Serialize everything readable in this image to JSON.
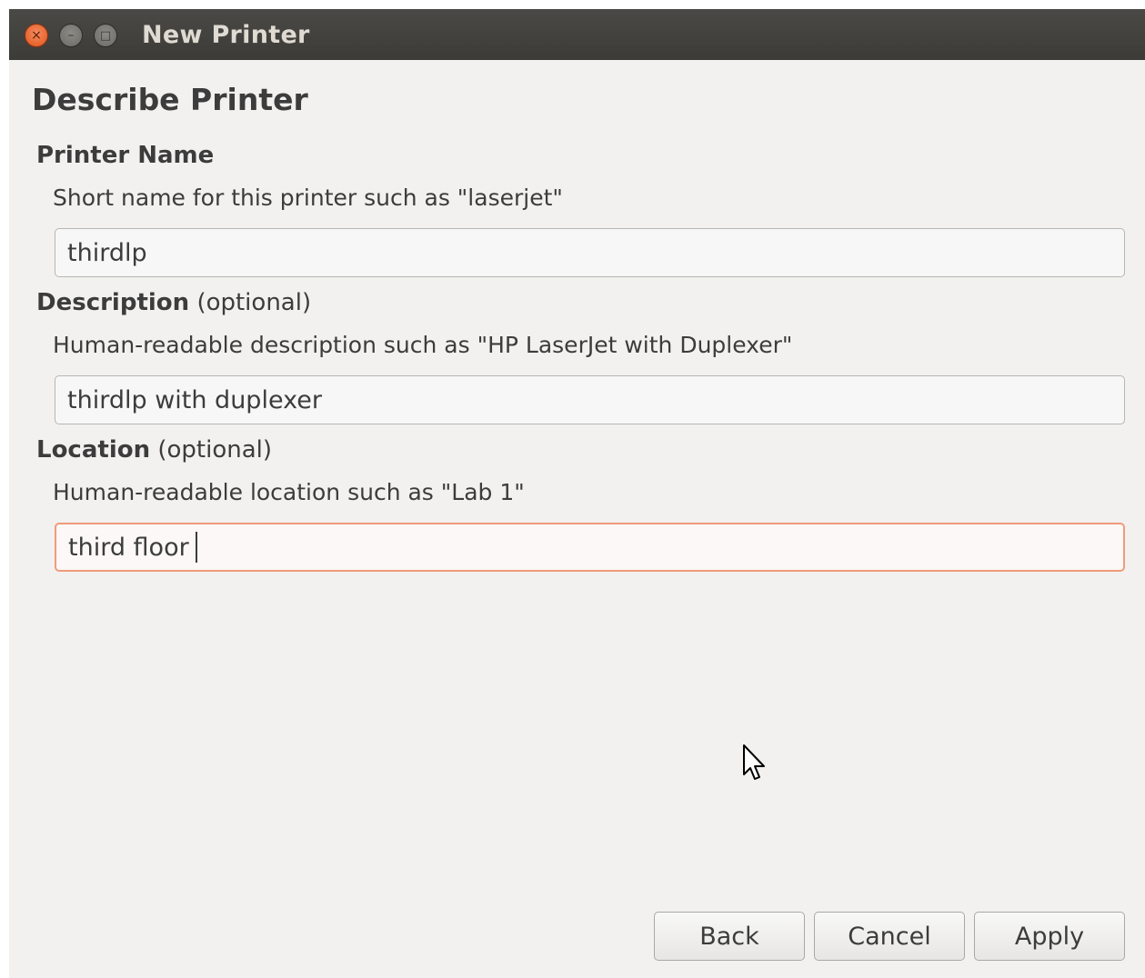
{
  "window": {
    "title": "New Printer",
    "close_glyph": "×",
    "minimize_glyph": "–",
    "maximize_glyph": "□"
  },
  "page": {
    "heading": "Describe Printer"
  },
  "printer_name": {
    "label": "Printer Name",
    "hint": "Short name for this printer such as \"laserjet\"",
    "value": "thirdlp"
  },
  "description": {
    "label": "Description",
    "optional": "(optional)",
    "hint": "Human-readable description such as \"HP LaserJet with Duplexer\"",
    "value": "thirdlp with duplexer"
  },
  "location": {
    "label": "Location",
    "optional": "(optional)",
    "hint": "Human-readable location such as \"Lab 1\"",
    "value": "third floor"
  },
  "buttons": {
    "back": "Back",
    "cancel": "Cancel",
    "apply": "Apply"
  },
  "colors": {
    "titlebar": "#3c3b37",
    "close_button": "#e1541b",
    "focus_border": "#f19b7a",
    "background": "#f2f1f0"
  },
  "icons": {
    "close": "close-icon",
    "minimize": "minimize-icon",
    "maximize": "maximize-icon",
    "pointer": "mouse-pointer-icon"
  }
}
